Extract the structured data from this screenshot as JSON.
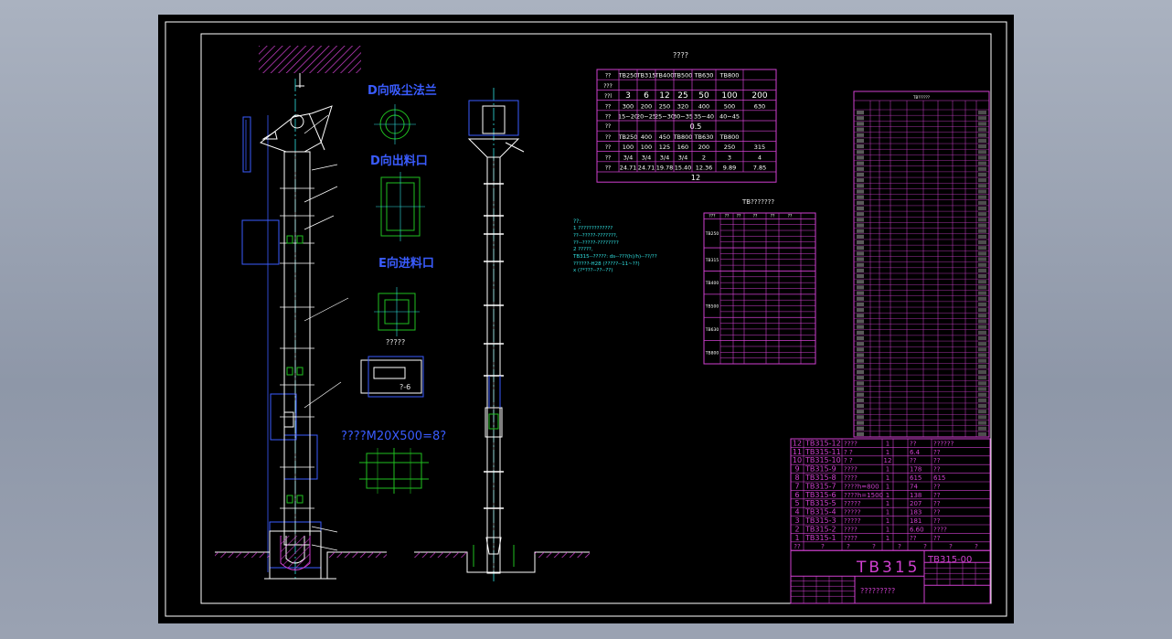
{
  "colors": {
    "background": "#000000",
    "border": "#ffffff",
    "outline": "#ffffff",
    "centerline": "#30e0e0",
    "dimension": "#3a5cff",
    "table": "#d040d0",
    "flange": "#20c020",
    "hatch": "#d040d0"
  },
  "views": {
    "d_inlet_flange": "D向吸尘法兰",
    "d_discharge": "D向出料口",
    "e_feed": "E向进料口",
    "small_label": "?????",
    "section_label": "?-6",
    "bolt_note": "????M20X500=8?"
  },
  "spec_table": {
    "title": "????",
    "rows": [
      [
        "??",
        "TB250",
        "TB315",
        "TB400",
        "TB500",
        "TB630",
        "TB800"
      ],
      [
        "???",
        "",
        "",
        "",
        "",
        "",
        ""
      ],
      [
        "??l",
        "3",
        "6",
        "12",
        "25",
        "50",
        "100",
        "200"
      ],
      [
        "??",
        "300",
        "200",
        "250",
        "320",
        "400",
        "500",
        "630"
      ],
      [
        "??",
        "15~20",
        "20~25",
        "25~30",
        "30~35",
        "35~40",
        "40~45"
      ],
      [
        "??",
        "0.5"
      ],
      [
        "??",
        "TB250",
        "400",
        "450",
        "TB800",
        "TB630",
        "TB800"
      ],
      [
        "??",
        "100",
        "100",
        "125",
        "160",
        "200",
        "250",
        "315"
      ],
      [
        "??",
        "3/4",
        "3/4",
        "3/4",
        "3/4",
        "2",
        "3",
        "4"
      ],
      [
        "??",
        "24.71",
        "24.71",
        "19.78",
        "15.40",
        "12.36",
        "9.89",
        "7.85"
      ],
      [
        "",
        "12"
      ]
    ]
  },
  "notes": {
    "heading": "??:",
    "lines": [
      "1 ?????????????",
      "   ??--?????-???????,",
      "   ??--?????-????????",
      "2 ?????,",
      "   TB315--?????: ds--???(h)/h)--??/??",
      "   ??????-H28 (?????--11~??)",
      "            x (?*???--??--??)"
    ]
  },
  "motor_table": {
    "title": "TB???????",
    "header": [
      "???",
      "??",
      "??",
      "??",
      "??",
      "??"
    ],
    "groups": [
      {
        "label": "TB250",
        "rows": 5
      },
      {
        "label": "TB315",
        "rows": 4
      },
      {
        "label": "TB400",
        "rows": 4
      },
      {
        "label": "TB500",
        "rows": 4
      },
      {
        "label": "TB630",
        "rows": 4
      },
      {
        "label": "TB800",
        "rows": 4
      }
    ]
  },
  "height_table": {
    "title": "TB??????",
    "row_count": 58
  },
  "bom": {
    "rows": [
      {
        "no": "12",
        "code": "TB315-12",
        "name": "????",
        "qty": "1",
        "weight": "??",
        "note": "??????"
      },
      {
        "no": "11",
        "code": "TB315-11",
        "name": "? ?",
        "qty": "1",
        "weight": "6.4",
        "note": "??"
      },
      {
        "no": "10",
        "code": "TB315-10",
        "name": "? ?",
        "qty": "12",
        "weight": "??",
        "note": "??"
      },
      {
        "no": "9",
        "code": "TB315-9",
        "name": "????",
        "qty": "1",
        "weight": "178",
        "note": "??"
      },
      {
        "no": "8",
        "code": "TB315-8",
        "name": "????",
        "qty": "1",
        "weight": "615",
        "note": "615"
      },
      {
        "no": "7",
        "code": "TB315-7",
        "name": "????h=800",
        "qty": "1",
        "weight": "74",
        "note": "??"
      },
      {
        "no": "6",
        "code": "TB315-6",
        "name": "????h=1500",
        "qty": "1",
        "weight": "138",
        "note": "??"
      },
      {
        "no": "5",
        "code": "TB315-5",
        "name": "?????",
        "qty": "1",
        "weight": "207",
        "note": "??"
      },
      {
        "no": "4",
        "code": "TB315-4",
        "name": "?????",
        "qty": "1",
        "weight": "183",
        "note": "??"
      },
      {
        "no": "3",
        "code": "TB315-3",
        "name": "?????",
        "qty": "1",
        "weight": "181",
        "note": "??"
      },
      {
        "no": "2",
        "code": "TB315-2",
        "name": "????",
        "qty": "1",
        "weight": "6.60",
        "note": "????"
      },
      {
        "no": "1",
        "code": "TB315-1",
        "name": "????",
        "qty": "1",
        "weight": "??",
        "note": "??"
      }
    ],
    "header": [
      "??",
      "?",
      "?",
      "?",
      "?",
      "?",
      "?",
      "?"
    ]
  },
  "title_block": {
    "model": "TB315",
    "drawing_no": "TB315-00",
    "company": "?????????"
  }
}
